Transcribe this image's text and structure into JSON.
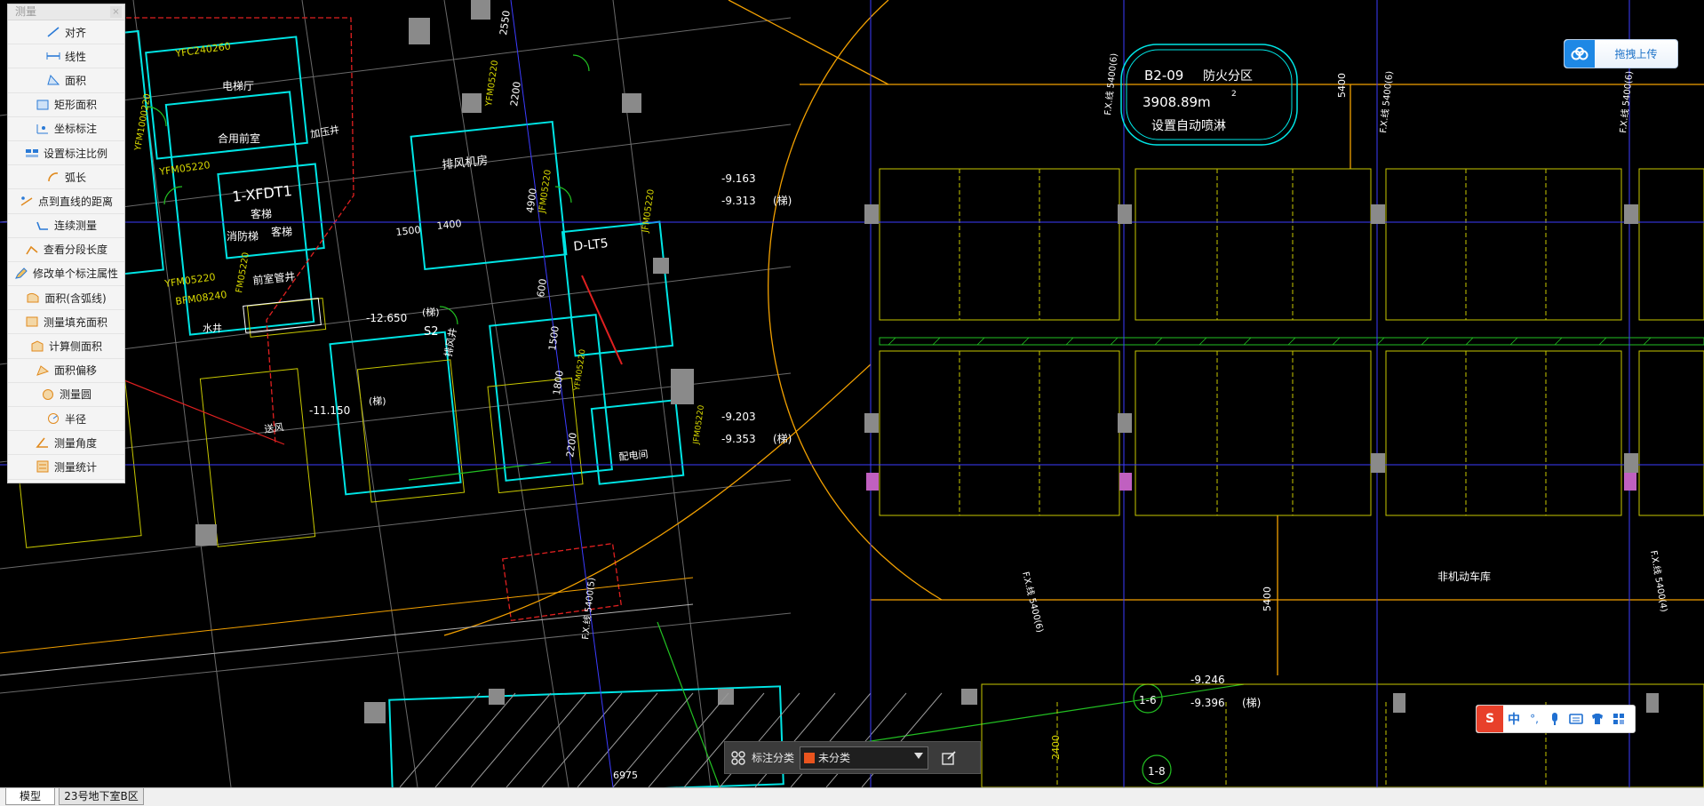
{
  "drawing": {
    "labels": [
      "YFC240260",
      "YFM1000220",
      "电梯厅",
      "合用前室",
      "加压井",
      "YFM05220",
      "1-XFDT1",
      "客梯",
      "消防梯",
      "客梯",
      "FM05220",
      "前室管井",
      "YFM05220",
      "BFM08240",
      "水井",
      "排风机房",
      "2550",
      "2200",
      "YFM05220",
      "JFM05220",
      "4900",
      "1500",
      "1400",
      "D-LT5",
      "JFM05220",
      "-12.650",
      "(梯)",
      "S2",
      "600",
      "1500",
      "1800",
      "2200",
      "YFM05220",
      "排风井",
      "-11.150",
      "(梯)",
      "送风",
      "-9.163",
      "-9.313",
      "(梯)",
      "-9.203",
      "-9.353",
      "(梯)",
      "配电间",
      "JFM05220",
      "B2-09",
      "防火分区",
      "3908.89m",
      "2",
      "设置自动喷淋",
      "5400",
      "非机动车库",
      "5400",
      "-9.246",
      "-9.396",
      "(梯)",
      "2400",
      "6975",
      "1-6",
      "1-8",
      "F.X.线 5400(6)",
      "F.X.线 5400(6)",
      "F.X.线 5400(4)",
      "F.X.线 5400(5)",
      "F.X.线 5400(6)",
      "F.X.线 5400(6)"
    ]
  },
  "measure_panel": {
    "title": "测量",
    "close": "×",
    "items": [
      {
        "label": "对齐",
        "icon": "align-icon"
      },
      {
        "label": "线性",
        "icon": "linear-measure-icon"
      },
      {
        "label": "面积",
        "icon": "area-icon"
      },
      {
        "label": "矩形面积",
        "icon": "rect-area-icon"
      },
      {
        "label": "坐标标注",
        "icon": "coordinate-icon"
      },
      {
        "label": "设置标注比例",
        "icon": "scale-icon"
      },
      {
        "label": "弧长",
        "icon": "arc-length-icon"
      },
      {
        "label": "点到直线的距离",
        "icon": "point-line-distance-icon"
      },
      {
        "label": "连续测量",
        "icon": "continuous-measure-icon"
      },
      {
        "label": "查看分段长度",
        "icon": "segment-length-icon"
      },
      {
        "label": "修改单个标注属性",
        "icon": "edit-annotation-icon"
      },
      {
        "label": "面积(含弧线)",
        "icon": "arc-area-icon"
      },
      {
        "label": "测量填充面积",
        "icon": "fill-area-icon"
      },
      {
        "label": "计算侧面积",
        "icon": "side-area-icon"
      },
      {
        "label": "面积偏移",
        "icon": "area-offset-icon"
      },
      {
        "label": "测量圆",
        "icon": "circle-measure-icon"
      },
      {
        "label": "半径",
        "icon": "radius-icon"
      },
      {
        "label": "测量角度",
        "icon": "angle-icon"
      },
      {
        "label": "测量统计",
        "icon": "statistics-icon"
      }
    ]
  },
  "upload": {
    "label": "拖拽上传",
    "icon": "baidu-cloud-icon"
  },
  "ime": {
    "logo": "S",
    "mode": "中",
    "punct": "°,",
    "icons": [
      "mic-icon",
      "keyboard-icon",
      "shirt-icon",
      "apps-icon"
    ]
  },
  "annotation_bar": {
    "label": "标注分类",
    "selected": "未分类",
    "swatch": "#e9541e",
    "icons": [
      "grid-icon",
      "edit-icon"
    ]
  },
  "tabs": [
    {
      "label": "模型",
      "active": true
    },
    {
      "label": "23号地下室B区",
      "active": false
    }
  ],
  "colors": {
    "background": "#000000",
    "cyan": "#00e5e5",
    "yellow": "#d8d800",
    "green": "#22c022",
    "red": "#e02020",
    "white": "#ffffff",
    "orange": "#f2a000",
    "accent": "#1e88e5"
  }
}
